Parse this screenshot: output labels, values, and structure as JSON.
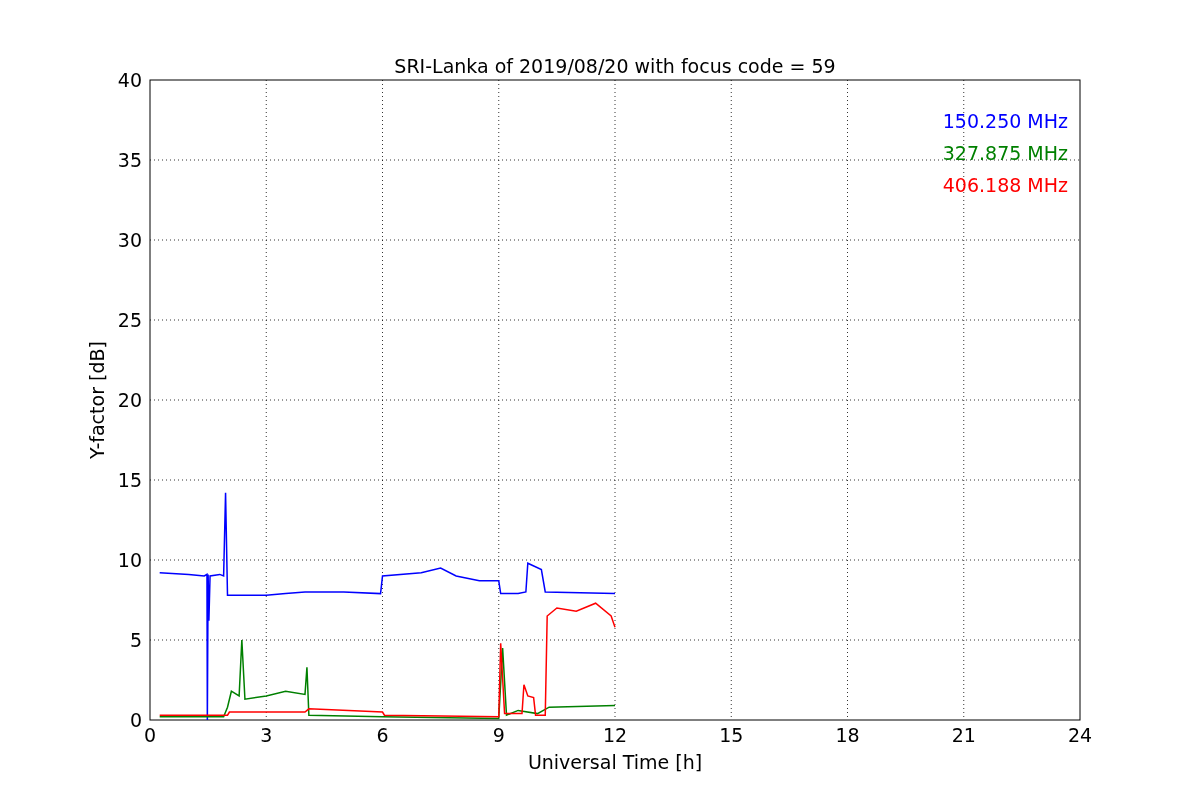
{
  "figure": {
    "chart_data": {
      "type": "line",
      "title": "SRI-Lanka of 2019/08/20 with focus code = 59",
      "xlabel": "Universal Time [h]",
      "ylabel": "Y-factor [dB]",
      "xlim": [
        0,
        24
      ],
      "ylim": [
        0,
        40
      ],
      "xticks": [
        0,
        3,
        6,
        9,
        12,
        15,
        18,
        21,
        24
      ],
      "yticks": [
        0,
        5,
        10,
        15,
        20,
        25,
        30,
        35,
        40
      ],
      "grid": true,
      "series": [
        {
          "name": "150.250 MHz",
          "color": "#0000ff",
          "x": [
            0.25,
            1.0,
            1.4,
            1.47,
            1.48,
            1.5,
            1.52,
            1.55,
            1.8,
            1.9,
            1.95,
            2.0,
            3.0,
            3.5,
            4.0,
            5.0,
            5.95,
            6.0,
            7.0,
            7.5,
            7.9,
            8.5,
            9.0,
            9.05,
            9.5,
            9.7,
            9.75,
            10.1,
            10.2,
            12.0
          ],
          "values": [
            9.2,
            9.1,
            9.0,
            9.1,
            0,
            9.1,
            6.2,
            9.0,
            9.1,
            9.0,
            14.2,
            7.8,
            7.8,
            7.9,
            8.0,
            8.0,
            7.9,
            9.0,
            9.2,
            9.5,
            9.0,
            8.7,
            8.7,
            7.9,
            7.9,
            8.0,
            9.8,
            9.4,
            8.0,
            7.9
          ]
        },
        {
          "name": "327.875 MHz",
          "color": "#008000",
          "x": [
            0.25,
            1.9,
            2.0,
            2.1,
            2.3,
            2.37,
            2.45,
            3.0,
            3.5,
            4.0,
            4.05,
            4.1,
            6.0,
            9.0,
            9.1,
            9.2,
            9.5,
            10.0,
            10.3,
            12.0
          ],
          "values": [
            0.2,
            0.2,
            0.8,
            1.8,
            1.5,
            5.0,
            1.3,
            1.5,
            1.8,
            1.6,
            3.3,
            0.3,
            0.2,
            0.1,
            4.5,
            0.3,
            0.6,
            0.4,
            0.8,
            0.9
          ]
        },
        {
          "name": "406.188 MHz",
          "color": "#ff0000",
          "x": [
            0.25,
            2.0,
            2.05,
            4.0,
            4.1,
            6.0,
            6.05,
            9.0,
            9.05,
            9.15,
            9.6,
            9.65,
            9.75,
            9.9,
            9.95,
            10.2,
            10.25,
            10.5,
            11.0,
            11.5,
            11.9,
            12.0
          ],
          "values": [
            0.3,
            0.3,
            0.5,
            0.5,
            0.7,
            0.5,
            0.3,
            0.2,
            4.8,
            0.4,
            0.4,
            2.2,
            1.5,
            1.4,
            0.3,
            0.3,
            6.5,
            7.0,
            6.8,
            7.3,
            6.5,
            5.8
          ]
        }
      ]
    }
  }
}
